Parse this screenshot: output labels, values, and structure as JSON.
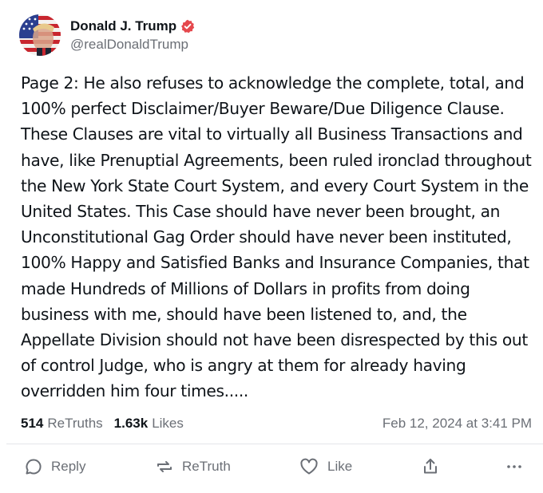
{
  "author": {
    "display_name": "Donald J. Trump",
    "handle": "@realDonaldTrump",
    "verified_badge_color": "#e5484d"
  },
  "post": {
    "text": "Page 2: He also refuses to acknowledge the complete, total, and 100% perfect Disclaimer/Buyer Beware/Due Diligence Clause. These Clauses are vital to virtually all Business Transactions and have, like Prenuptial Agreements, been ruled ironclad throughout the New York State Court System, and every Court System in the United States. This Case should have never been brought, an Unconstitutional Gag Order should have never been instituted, 100% Happy and Satisfied Banks and Insurance Companies, that made Hundreds of Millions of Dollars in profits from doing business with me, should have been listened to, and, the Appellate Division should not have been disrespected by this out of control Judge, who is angry at them for already having overridden him four times....."
  },
  "stats": {
    "retruths_count": "514",
    "retruths_label": "ReTruths",
    "likes_count": "1.63k",
    "likes_label": "Likes",
    "timestamp": "Feb 12, 2024 at 3:41 PM"
  },
  "actions": {
    "reply_label": "Reply",
    "retruth_label": "ReTruth",
    "like_label": "Like"
  },
  "icons": {
    "reply": "speech-bubble-icon",
    "retruth": "repost-arrows-icon",
    "like": "heart-icon",
    "share": "share-upload-icon",
    "more": "more-dots-icon",
    "verified": "verified-check-icon"
  },
  "colors": {
    "text_primary": "#0f1419",
    "text_secondary": "#6b6f76",
    "divider": "#e4e6ea",
    "verified": "#e5484d"
  }
}
